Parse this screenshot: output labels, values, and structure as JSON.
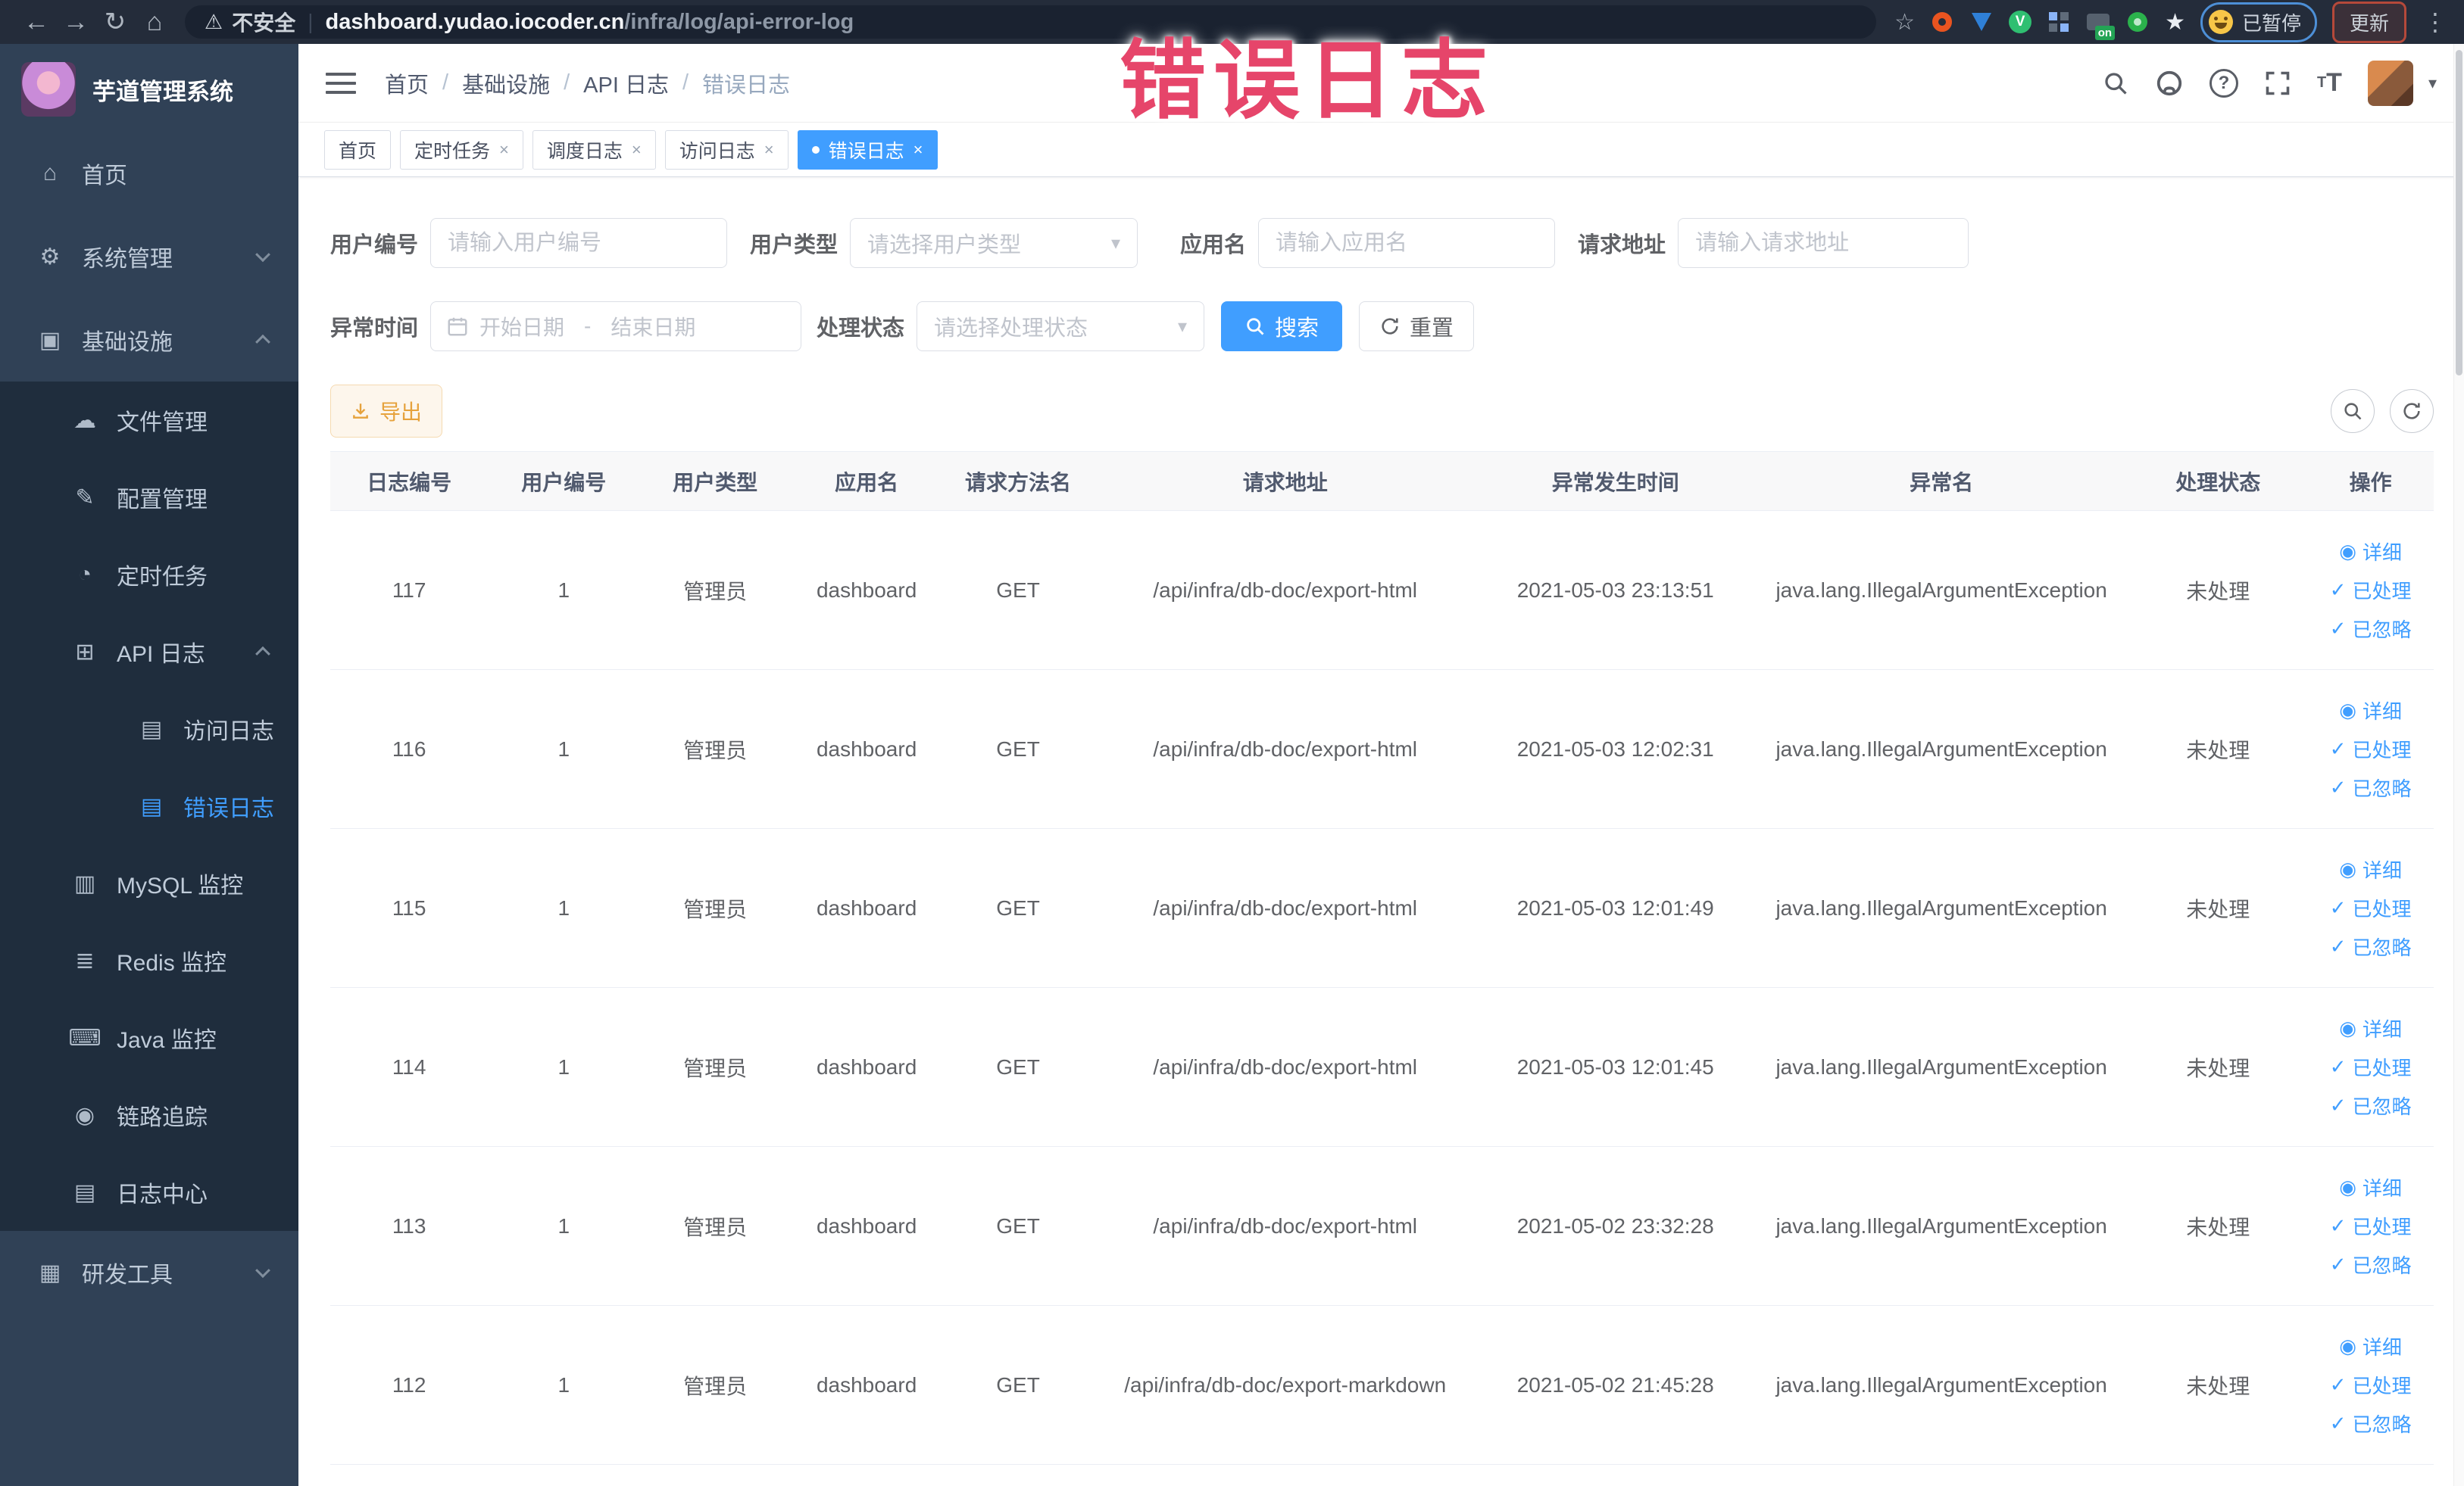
{
  "browser": {
    "security_label": "不安全",
    "url_host": "dashboard.yudao.iocoder.cn",
    "url_path": "/infra/log/api-error-log",
    "ext_on_badge": "on",
    "paused_badge": "已暂停",
    "update_button": "更新"
  },
  "annotation": {
    "text": "错误日志"
  },
  "sidebar": {
    "title": "芋道管理系统",
    "items": [
      {
        "label": "首页"
      },
      {
        "label": "系统管理"
      },
      {
        "label": "基础设施"
      },
      {
        "label": "文件管理"
      },
      {
        "label": "配置管理"
      },
      {
        "label": "定时任务"
      },
      {
        "label": "API 日志"
      },
      {
        "label": "访问日志"
      },
      {
        "label": "错误日志"
      },
      {
        "label": "MySQL 监控"
      },
      {
        "label": "Redis 监控"
      },
      {
        "label": "Java 监控"
      },
      {
        "label": "链路追踪"
      },
      {
        "label": "日志中心"
      },
      {
        "label": "研发工具"
      }
    ]
  },
  "breadcrumb": [
    "首页",
    "基础设施",
    "API 日志",
    "错误日志"
  ],
  "tabs": [
    {
      "label": "首页"
    },
    {
      "label": "定时任务"
    },
    {
      "label": "调度日志"
    },
    {
      "label": "访问日志"
    },
    {
      "label": "错误日志"
    }
  ],
  "filters": {
    "user_id_label": "用户编号",
    "user_id_placeholder": "请输入用户编号",
    "user_type_label": "用户类型",
    "user_type_placeholder": "请选择用户类型",
    "app_name_label": "应用名",
    "app_name_placeholder": "请输入应用名",
    "request_url_label": "请求地址",
    "request_url_placeholder": "请输入请求地址",
    "time_label": "异常时间",
    "time_start_placeholder": "开始日期",
    "time_separator": "-",
    "time_end_placeholder": "结束日期",
    "status_label": "处理状态",
    "status_placeholder": "请选择处理状态",
    "search_button": "搜索",
    "reset_button": "重置"
  },
  "toolbar": {
    "export_button": "导出"
  },
  "table": {
    "columns": [
      "日志编号",
      "用户编号",
      "用户类型",
      "应用名",
      "请求方法名",
      "请求地址",
      "异常发生时间",
      "异常名",
      "处理状态",
      "操作"
    ],
    "actions": [
      "详细",
      "已处理",
      "已忽略"
    ],
    "rows": [
      [
        "117",
        "1",
        "管理员",
        "dashboard",
        "GET",
        "/api/infra/db-doc/export-html",
        "2021-05-03 23:13:51",
        "java.lang.IllegalArgumentException",
        "未处理"
      ],
      [
        "116",
        "1",
        "管理员",
        "dashboard",
        "GET",
        "/api/infra/db-doc/export-html",
        "2021-05-03 12:02:31",
        "java.lang.IllegalArgumentException",
        "未处理"
      ],
      [
        "115",
        "1",
        "管理员",
        "dashboard",
        "GET",
        "/api/infra/db-doc/export-html",
        "2021-05-03 12:01:49",
        "java.lang.IllegalArgumentException",
        "未处理"
      ],
      [
        "114",
        "1",
        "管理员",
        "dashboard",
        "GET",
        "/api/infra/db-doc/export-html",
        "2021-05-03 12:01:45",
        "java.lang.IllegalArgumentException",
        "未处理"
      ],
      [
        "113",
        "1",
        "管理员",
        "dashboard",
        "GET",
        "/api/infra/db-doc/export-html",
        "2021-05-02 23:32:28",
        "java.lang.IllegalArgumentException",
        "未处理"
      ],
      [
        "112",
        "1",
        "管理员",
        "dashboard",
        "GET",
        "/api/infra/db-doc/export-markdown",
        "2021-05-02 21:45:28",
        "java.lang.IllegalArgumentException",
        "未处理"
      ]
    ]
  }
}
